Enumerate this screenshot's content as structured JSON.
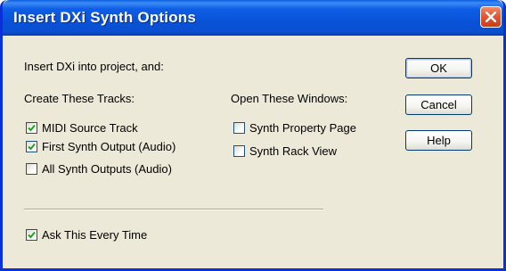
{
  "dialog": {
    "title": "Insert DXi Synth Options",
    "intro": "Insert DXi into project, and:"
  },
  "tracks": {
    "heading": "Create These Tracks:",
    "options": [
      {
        "label": "MIDI Source Track",
        "checked": true
      },
      {
        "label": "First Synth Output (Audio)",
        "checked": true
      },
      {
        "label": "All Synth Outputs (Audio)",
        "checked": false
      }
    ]
  },
  "windows": {
    "heading": "Open These Windows:",
    "options": [
      {
        "label": "Synth Property Page",
        "checked": false
      },
      {
        "label": "Synth Rack View",
        "checked": false
      }
    ]
  },
  "ask_every_time": {
    "label": "Ask This Every Time",
    "checked": true
  },
  "buttons": {
    "ok": "OK",
    "cancel": "Cancel",
    "help": "Help"
  },
  "icons": {
    "close": "close-icon",
    "check": "checkmark-icon"
  },
  "colors": {
    "titlebar": "#0852d8",
    "close_button": "#e15a33",
    "dialog_face": "#ece9d8",
    "checkmark": "#21a121",
    "checkbox_border": "#1c5180"
  }
}
